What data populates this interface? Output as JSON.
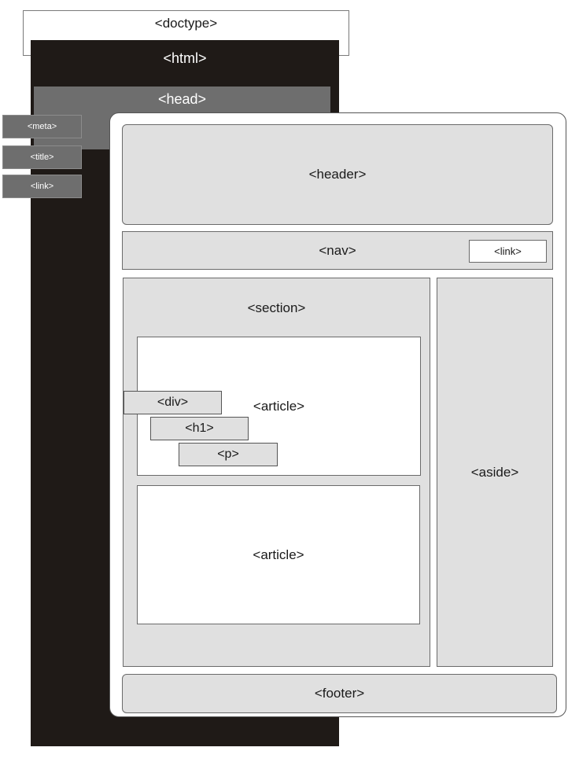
{
  "diagram": {
    "doctype": "<doctype>",
    "html": "<html>",
    "head": "<head>",
    "head_children": [
      "<meta>",
      "<title>",
      "<link>"
    ],
    "body": {
      "header": "<header>",
      "nav": "<nav>",
      "nav_link": "<link>",
      "section": "<section>",
      "article_1": "<article>",
      "article_2": "<article>",
      "div": "<div>",
      "h1": "<h1>",
      "p": "<p>",
      "aside": "<aside>",
      "footer": "<footer>"
    }
  },
  "colors": {
    "html_block": "#1f1a17",
    "head_block": "#6e6e6e",
    "element_fill": "#e0e0e0",
    "card_fill": "#ffffff"
  }
}
